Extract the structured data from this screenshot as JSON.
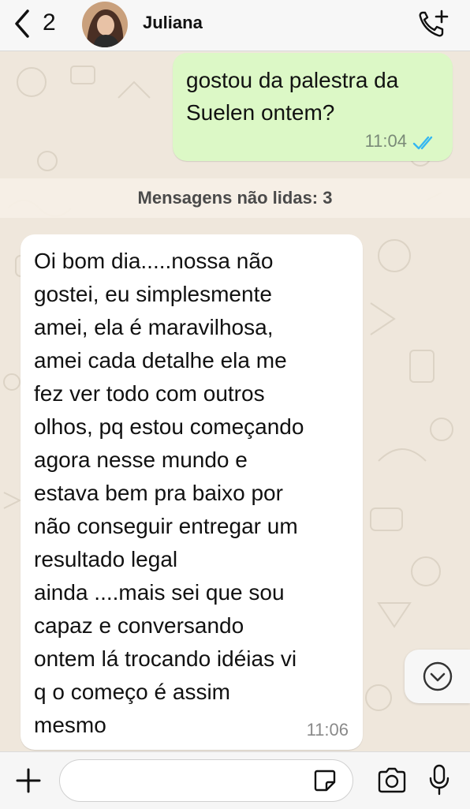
{
  "header": {
    "back_count": "2",
    "contact_name": "Juliana"
  },
  "messages": [
    {
      "direction": "outgoing",
      "text": "gostou da palestra da\nSuelen ontem?",
      "time": "11:04",
      "status": "read"
    },
    {
      "direction": "incoming",
      "text": "Oi bom dia.....nossa não\ngostei, eu simplesmente\namei, ela é maravilhosa,\namei cada detalhe ela me\nfez ver todo com outros\nolhos, pq estou começando\nagora nesse mundo e\nestava bem pra baixo por\nnão conseguir entregar um\nresultado legal\nainda ....mais sei que sou\ncapaz e conversando\nontem lá trocando idéias vi\nq o começo é assim\nmesmo",
      "time": "11:06"
    }
  ],
  "unread_divider": "Mensagens não lidas: 3",
  "composer": {
    "value": "",
    "placeholder": ""
  },
  "icons": {
    "back": "chevron-left-icon",
    "call": "phone-add-icon",
    "read_ticks": "double-check-icon",
    "scroll": "chevron-down-circle-icon",
    "attach": "plus-icon",
    "sticker": "sticker-icon",
    "camera": "camera-icon",
    "mic": "microphone-icon"
  },
  "colors": {
    "outgoing_bubble": "#dcf8c6",
    "incoming_bubble": "#ffffff",
    "read_ticks": "#34b7f1",
    "background": "#efe7dc"
  }
}
